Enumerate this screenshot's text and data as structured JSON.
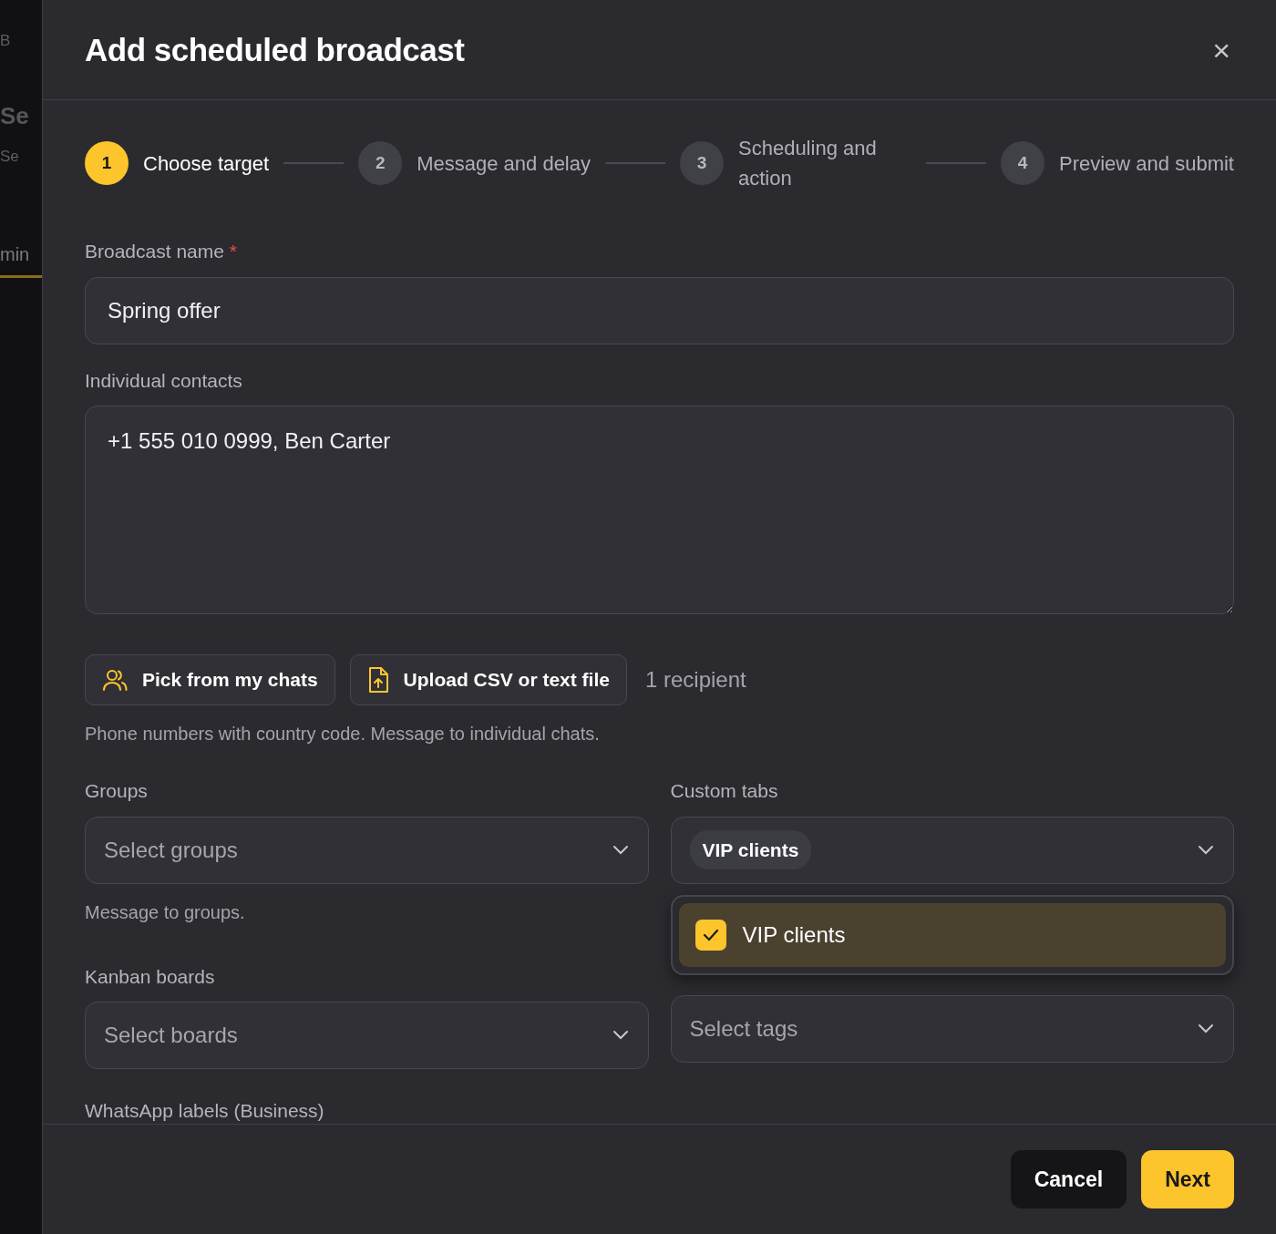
{
  "background": {
    "fragments": [
      {
        "text": "B",
        "kind": "muted"
      },
      {
        "text": "Se",
        "kind": "title"
      },
      {
        "text": "Se",
        "kind": "muted"
      },
      {
        "text": "min",
        "kind": "tab"
      }
    ]
  },
  "dialog": {
    "title": "Add scheduled broadcast",
    "close": "×"
  },
  "steps": [
    {
      "number": "1",
      "label": "Choose target",
      "selected": true
    },
    {
      "number": "2",
      "label": "Message and delay",
      "selected": false
    },
    {
      "number": "3",
      "label": "Scheduling and action",
      "selected": false
    },
    {
      "number": "4",
      "label": "Preview and submit",
      "selected": false
    }
  ],
  "broadcast_name": {
    "label": "Broadcast name",
    "required_mark": "*",
    "value": "Spring offer"
  },
  "individual_contacts": {
    "label": "Individual contacts",
    "value": "+1 555 010 0999, Ben Carter",
    "buttons": [
      {
        "label": "Pick from my chats",
        "kind": "people"
      },
      {
        "label": "Upload CSV or text file",
        "kind": "upload"
      }
    ],
    "count": "1 recipient",
    "help": "Phone numbers with country code. Message to individual chats."
  },
  "groups": {
    "label": "Groups",
    "placeholder": "Select groups",
    "help": "Message to groups."
  },
  "custom_tabs": {
    "label": "Custom tabs",
    "chips": [
      "VIP clients"
    ],
    "options": [
      {
        "label": "VIP clients",
        "checked": true
      }
    ]
  },
  "kanban_boards": {
    "label": "Kanban boards",
    "placeholder": "Select boards"
  },
  "crm_tags": {
    "placeholder": "Select tags"
  },
  "whatsapp_labels": {
    "label": "WhatsApp labels (Business)"
  },
  "footer": {
    "buttons": [
      {
        "label": "Cancel",
        "kind": "secondary"
      },
      {
        "label": "Next",
        "kind": "primary"
      }
    ]
  }
}
